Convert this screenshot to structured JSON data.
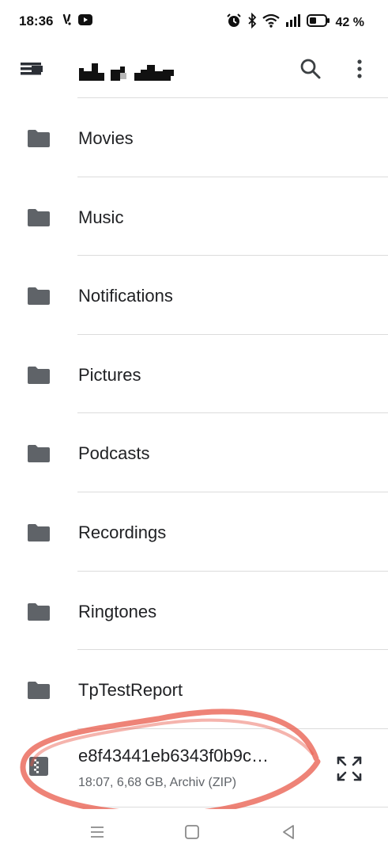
{
  "status_bar": {
    "time": "18:36",
    "battery_percent": "42 %",
    "left_icons": [
      "missed-call-icon",
      "youtube-icon"
    ],
    "right_icons": [
      "alarm-icon",
      "bluetooth-icon",
      "wifi-icon",
      "signal-icon",
      "battery-icon"
    ]
  },
  "app_bar": {
    "icons": [
      "menu-icon",
      "search-icon",
      "more-vert-icon"
    ]
  },
  "folders": [
    {
      "label": "Movies"
    },
    {
      "label": "Music"
    },
    {
      "label": "Notifications"
    },
    {
      "label": "Pictures"
    },
    {
      "label": "Podcasts"
    },
    {
      "label": "Recordings"
    },
    {
      "label": "Ringtones"
    },
    {
      "label": "TpTestReport"
    }
  ],
  "file": {
    "name": "e8f43441eb6343f0b9c…",
    "meta": "18:07, 6,68 GB, Archiv (ZIP)",
    "icon": "zip-archive-icon",
    "action_icon": "expand-icon"
  },
  "nav_bar": {
    "icons": [
      "recents-icon",
      "home-icon",
      "back-icon"
    ]
  },
  "colors": {
    "icon_gray": "#5f6368",
    "text": "#202124",
    "divider": "#dcdcdc",
    "annotation": "#e8594a"
  }
}
